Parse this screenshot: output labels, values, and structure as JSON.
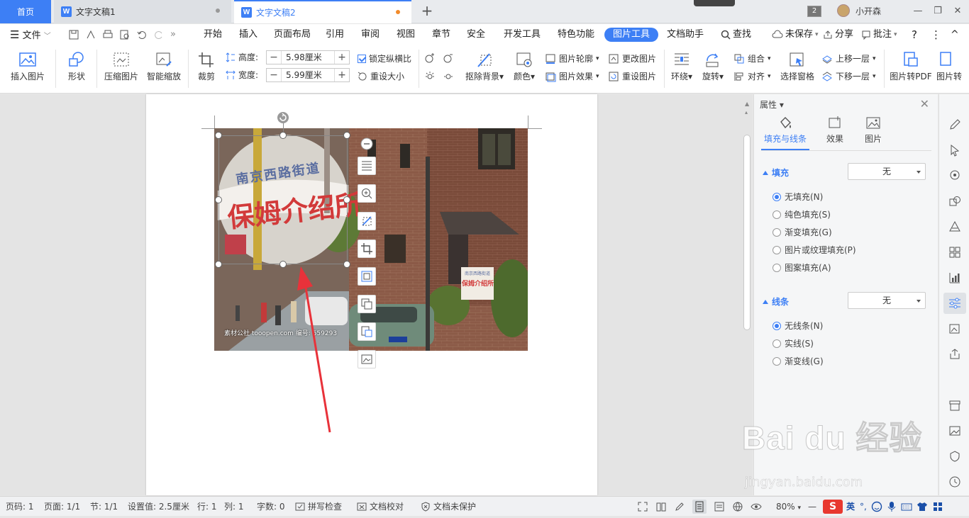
{
  "tabs": {
    "home": "首页",
    "doc1": "文字文稿1",
    "doc2": "文字文稿2",
    "doc_badge": "W",
    "new_tab": "+",
    "window_count": "2",
    "user_name": "小开森"
  },
  "menu": {
    "file": "文件",
    "items": [
      "开始",
      "插入",
      "页面布局",
      "引用",
      "审阅",
      "视图",
      "章节",
      "安全",
      "开发工具",
      "特色功能",
      "图片工具",
      "文档助手"
    ],
    "search": "查找",
    "unsaved": "未保存",
    "share": "分享",
    "comment": "批注",
    "help": "?",
    "more": "⋮",
    "collapse": "^"
  },
  "ribbon": {
    "insert_picture": "插入图片",
    "shape": "形状",
    "compress": "压缩图片",
    "smart_zoom": "智能缩放",
    "crop": "裁剪",
    "height_label": "高度:",
    "height_value": "5.98厘米",
    "width_label": "宽度:",
    "width_value": "5.99厘米",
    "lock_ratio": "锁定纵横比",
    "reset_size": "重设大小",
    "remove_bg": "抠除背景",
    "color": "颜色",
    "outline": "图片轮廓",
    "effects": "图片效果",
    "change_picture": "更改图片",
    "reset_picture": "重设图片",
    "wrap": "环绕",
    "rotate": "旋转",
    "group": "组合",
    "align": "对齐",
    "selection_pane": "选择窗格",
    "bring_forward": "上移一层",
    "send_backward": "下移一层",
    "to_pdf": "图片转PDF",
    "to_text": "图片转"
  },
  "photo": {
    "sign_big_top": "南京西路街道",
    "sign_big_main": "保姆介绍所",
    "sign_small_top": "南京西路街道",
    "sign_small_main": "保姆介绍所",
    "watermark": "素材公社 tooopen.com 编号: 559293"
  },
  "panel": {
    "title": "属性",
    "tabs": [
      "填充与线条",
      "效果",
      "图片"
    ],
    "fill_title": "填充",
    "fill_select": "无",
    "fill_options": [
      "无填充(N)",
      "纯色填充(S)",
      "渐变填充(G)",
      "图片或纹理填充(P)",
      "图案填充(A)"
    ],
    "line_title": "线条",
    "line_select": "无",
    "line_options": [
      "无线条(N)",
      "实线(S)",
      "渐变线(G)"
    ]
  },
  "status": {
    "page_num": "页码: 1",
    "pages": "页面: 1/1",
    "section": "节: 1/1",
    "setting": "设置值: 2.5厘米",
    "row": "行: 1",
    "col": "列: 1",
    "words": "字数: 0",
    "spell": "拼写检查",
    "proofread": "文档校对",
    "protect": "文档未保护",
    "zoom": "80%",
    "zoom_minus": "—",
    "ime": "英"
  },
  "watermark": {
    "main": "Bai du 经验",
    "sub": "jingyan.baidu.com"
  },
  "colors": {
    "accent": "#3d7ff5",
    "arrow": "#e8323a",
    "unsaved_dot": "#f28b2a"
  }
}
